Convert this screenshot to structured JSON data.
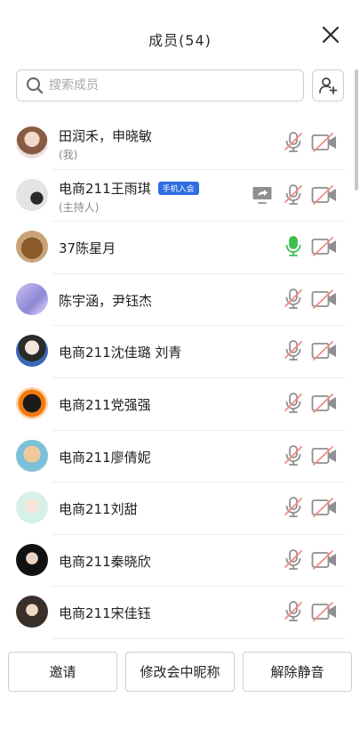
{
  "header": {
    "title": "成员(54)",
    "close_icon": "close-icon"
  },
  "search": {
    "placeholder": "搜索成员",
    "icon": "search-icon"
  },
  "add_member_icon": "add-user-icon",
  "colors": {
    "accent": "#2f6de1",
    "muted_red": "#f28b82",
    "mic_green": "#3fbf4f",
    "icon_gray": "#8f8f8f"
  },
  "members": [
    {
      "name": "田润禾，申晓敏",
      "sub": "(我)",
      "mic": "muted",
      "camera": "off"
    },
    {
      "name": "电商211王雨琪",
      "badge": "手机入会",
      "sub": "(主持人)",
      "share": true,
      "mic": "muted",
      "camera": "off"
    },
    {
      "name": "37陈星月",
      "mic": "on",
      "camera": "off"
    },
    {
      "name": "陈宇涵，尹钰杰",
      "mic": "muted",
      "camera": "off"
    },
    {
      "name": "电商211沈佳璐 刘青",
      "mic": "muted",
      "camera": "off"
    },
    {
      "name": "电商211党强强",
      "mic": "muted",
      "camera": "off"
    },
    {
      "name": "电商211廖倩妮",
      "mic": "muted",
      "camera": "off"
    },
    {
      "name": "电商211刘甜",
      "mic": "muted",
      "camera": "off"
    },
    {
      "name": "电商211秦晓欣",
      "mic": "muted",
      "camera": "off"
    },
    {
      "name": "电商211宋佳钰",
      "mic": "muted",
      "camera": "off"
    }
  ],
  "footer": {
    "invite": "邀请",
    "rename": "修改会中昵称",
    "unmute": "解除静音"
  }
}
